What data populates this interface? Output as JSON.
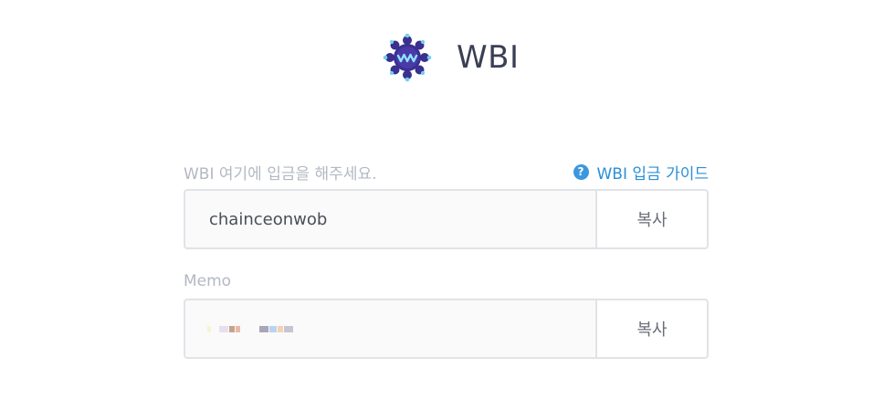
{
  "brand": {
    "logo_icon": "wbi-snowflake-logo",
    "title": "WBI"
  },
  "deposit": {
    "label": "WBI 여기에 입금을 해주세요.",
    "guide_icon": "help-circle-icon",
    "guide_icon_glyph": "?",
    "guide_link": "WBI 입금 가이드",
    "address": "chainceonwob",
    "copy_label": "복사"
  },
  "memo": {
    "label": "Memo",
    "value_obscured": true,
    "copy_label": "복사"
  },
  "colors": {
    "link": "#2a8fd8",
    "label": "#b3b8c2",
    "border": "#e1e3e7",
    "logo_primary": "#3b2f8f"
  }
}
